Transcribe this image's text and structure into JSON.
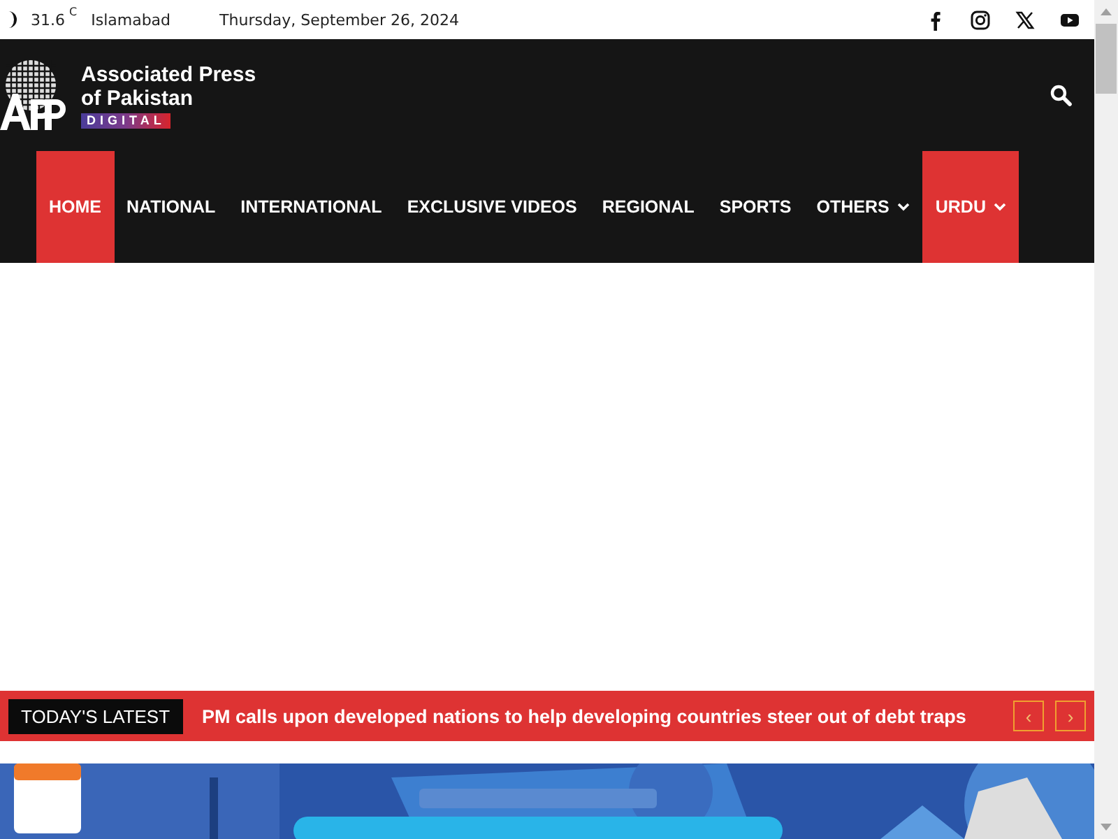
{
  "top_bar": {
    "temperature": "31.6",
    "unit": "C",
    "city": "Islamabad",
    "date": "Thursday, September 26, 2024"
  },
  "logo": {
    "line_1": "Associated Press",
    "line_2": "of Pakistan",
    "tagline": "DIGITAL"
  },
  "nav": [
    {
      "label": "HOME",
      "selected": true,
      "dropdown": false
    },
    {
      "label": "NATIONAL",
      "selected": false,
      "dropdown": false
    },
    {
      "label": "INTERNATIONAL",
      "selected": false,
      "dropdown": false
    },
    {
      "label": "EXCLUSIVE VIDEOS",
      "selected": false,
      "dropdown": false
    },
    {
      "label": "REGIONAL",
      "selected": false,
      "dropdown": false
    },
    {
      "label": "SPORTS",
      "selected": false,
      "dropdown": false
    },
    {
      "label": "OTHERS",
      "selected": false,
      "dropdown": true
    },
    {
      "label": "URDU",
      "selected": true,
      "dropdown": true
    }
  ],
  "ticker": {
    "label": "TODAY'S LATEST",
    "headline": "PM calls upon developed nations to help developing countries steer out of debt traps",
    "prev": "‹",
    "next": "›"
  }
}
